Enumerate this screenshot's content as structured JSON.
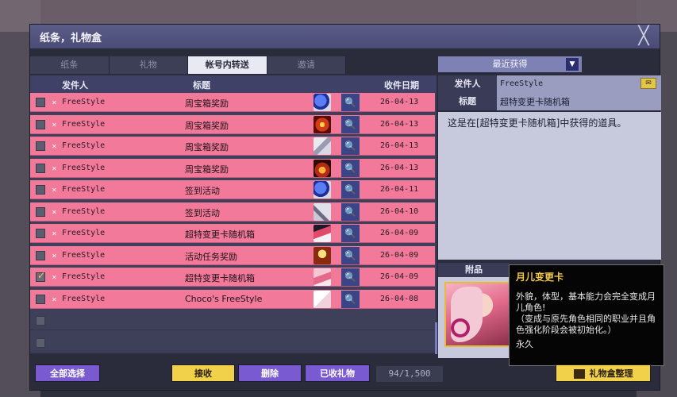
{
  "window": {
    "title": "纸条，礼物盒",
    "close": "╳"
  },
  "tabs": [
    {
      "label": "纸条",
      "active": false
    },
    {
      "label": "礼物",
      "active": false
    },
    {
      "label": "帐号内转送",
      "active": true
    },
    {
      "label": "邀请",
      "active": false
    }
  ],
  "sort": {
    "label": "最近获得",
    "arrow": "▼"
  },
  "list": {
    "headers": {
      "sender": "发件人",
      "subject": "标题",
      "date": "收件日期"
    },
    "rows": [
      {
        "sender": "FreeStyle",
        "subject": "周宝箱奖励",
        "date": "26-04-13",
        "checked": false,
        "icon": "blue-bell-icon"
      },
      {
        "sender": "FreeStyle",
        "subject": "周宝箱奖励",
        "date": "26-04-13",
        "checked": false,
        "icon": "crown-burst-icon"
      },
      {
        "sender": "FreeStyle",
        "subject": "周宝箱奖励",
        "date": "26-04-13",
        "checked": false,
        "icon": "silver-key-icon"
      },
      {
        "sender": "FreeStyle",
        "subject": "周宝箱奖励",
        "date": "26-04-13",
        "checked": false,
        "icon": "fire-emblem-icon"
      },
      {
        "sender": "FreeStyle",
        "subject": "签到活动",
        "date": "26-04-11",
        "checked": false,
        "icon": "blue-bell-icon"
      },
      {
        "sender": "FreeStyle",
        "subject": "签到活动",
        "date": "26-04-10",
        "checked": false,
        "icon": "hammer-icon"
      },
      {
        "sender": "FreeStyle",
        "subject": "超特变更卡随机箱",
        "date": "26-04-09",
        "checked": false,
        "icon": "card-box-icon"
      },
      {
        "sender": "FreeStyle",
        "subject": "活动任务奖励",
        "date": "26-04-09",
        "checked": false,
        "icon": "trophy-icon"
      },
      {
        "sender": "FreeStyle",
        "subject": "超特变更卡随机箱",
        "date": "26-04-09",
        "checked": true,
        "icon": "character-card-icon"
      },
      {
        "sender": "FreeStyle",
        "subject": "Choco's FreeStyle",
        "date": "26-04-08",
        "checked": false,
        "icon": "gift-tag-icon"
      }
    ],
    "empty_rows": 2
  },
  "detail": {
    "sender_label": "发件人",
    "sender_value": "FreeStyle",
    "title_label": "标题",
    "title_value": "超特变更卡随机箱",
    "description": "这是在[超特变更卡随机箱]中获得的道具。",
    "attachment_label": "附品"
  },
  "tooltip": {
    "title": "月儿变更卡",
    "line1": "外貌，体型，基本能力会完全变成月儿角色!",
    "line2": "（变成与原先角色相同的职业并且角色强化阶段会被初始化。）",
    "line3": "永久"
  },
  "footer": {
    "select_all": "全部选择",
    "receive": "接收",
    "delete": "删除",
    "received_gifts": "已收礼物",
    "counter": "94/1,500",
    "organize": "礼物盒整理"
  },
  "colors": {
    "row_pink": "#f2799a",
    "accent_purple": "#7a5ad0",
    "accent_yellow": "#f2d14a",
    "title_bar": "#4a4c77"
  }
}
